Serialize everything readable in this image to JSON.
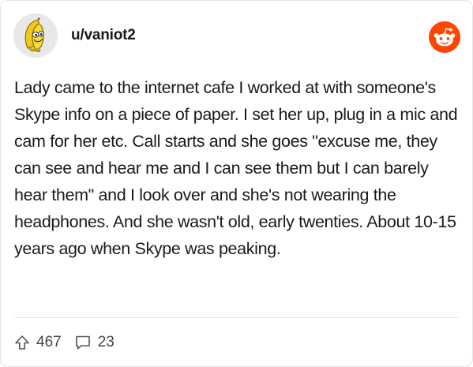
{
  "post": {
    "username": "u/vaniot2",
    "body": "Lady came to the internet cafe I worked at with someone's Skype info on a piece of paper. I set her up, plug in a mic and cam for her etc. Call starts and she goes \"excuse me, they can see and hear me and I can see them but I can barely hear them\" and I look over and she's not wearing the headphones. And she wasn't old, early twenties. About 10-15 years ago when Skype was peaking.",
    "upvotes": "467",
    "comments": "23"
  },
  "icons": {
    "avatar": "banana-avatar",
    "brand": "reddit-logo-icon",
    "upvote": "upvote-arrow-icon",
    "comment": "comment-bubble-icon"
  },
  "colors": {
    "brand": "#ff4500",
    "text": "#1a1a1b",
    "muted": "#444444"
  }
}
